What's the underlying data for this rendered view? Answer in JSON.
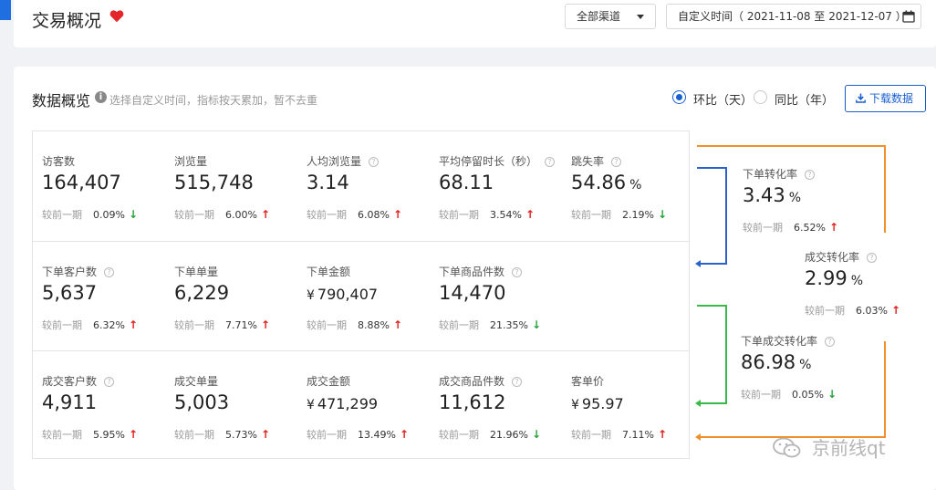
{
  "header": {
    "title": "交易概况",
    "channel": "全部渠道",
    "date_label": "自定义时间",
    "date_range": "（ 2021-11-08 至 2021-12-07 ）"
  },
  "overview": {
    "title": "数据概览",
    "hint": "选择自定义时间，指标按天累加，暂不去重",
    "ring_label": "环比（天）",
    "yoy_label": "同比（年）",
    "download_label": "下载数据"
  },
  "compare_label": "较前一期",
  "rows": [
    [
      {
        "label": "访客数",
        "help": false,
        "currency": "",
        "value": "164,407",
        "unit": "",
        "change": "0.09%",
        "dir": "down"
      },
      {
        "label": "浏览量",
        "help": false,
        "currency": "",
        "value": "515,748",
        "unit": "",
        "change": "6.00%",
        "dir": "up"
      },
      {
        "label": "人均浏览量",
        "help": true,
        "currency": "",
        "value": "3.14",
        "unit": "",
        "change": "6.08%",
        "dir": "up"
      },
      {
        "label": "平均停留时长（秒）",
        "help": true,
        "currency": "",
        "value": "68.11",
        "unit": "",
        "change": "3.54%",
        "dir": "up"
      },
      {
        "label": "跳失率",
        "help": true,
        "currency": "",
        "value": "54.86",
        "unit": "%",
        "change": "2.19%",
        "dir": "down"
      }
    ],
    [
      {
        "label": "下单客户数",
        "help": true,
        "currency": "",
        "value": "5,637",
        "unit": "",
        "change": "6.32%",
        "dir": "up"
      },
      {
        "label": "下单单量",
        "help": false,
        "currency": "",
        "value": "6,229",
        "unit": "",
        "change": "7.71%",
        "dir": "up"
      },
      {
        "label": "下单金额",
        "help": false,
        "currency": "¥",
        "value": "790,407",
        "unit": "",
        "change": "8.88%",
        "dir": "up"
      },
      {
        "label": "下单商品件数",
        "help": true,
        "currency": "",
        "value": "14,470",
        "unit": "",
        "change": "21.35%",
        "dir": "down"
      }
    ],
    [
      {
        "label": "成交客户数",
        "help": true,
        "currency": "",
        "value": "4,911",
        "unit": "",
        "change": "5.95%",
        "dir": "up"
      },
      {
        "label": "成交单量",
        "help": false,
        "currency": "",
        "value": "5,003",
        "unit": "",
        "change": "5.73%",
        "dir": "up"
      },
      {
        "label": "成交金额",
        "help": false,
        "currency": "¥",
        "value": "471,299",
        "unit": "",
        "change": "13.49%",
        "dir": "up"
      },
      {
        "label": "成交商品件数",
        "help": true,
        "currency": "",
        "value": "11,612",
        "unit": "",
        "change": "21.96%",
        "dir": "down"
      },
      {
        "label": "客单价",
        "help": false,
        "currency": "¥",
        "value": "95.97",
        "unit": "",
        "change": "7.11%",
        "dir": "up"
      }
    ]
  ],
  "conversions": [
    {
      "label": "下单转化率",
      "value": "3.43",
      "unit": "%",
      "change": "6.52%",
      "dir": "up"
    },
    {
      "label": "成交转化率",
      "value": "2.99",
      "unit": "%",
      "change": "6.03%",
      "dir": "up"
    },
    {
      "label": "下单成交转化率",
      "value": "86.98",
      "unit": "%",
      "change": "0.05%",
      "dir": "down"
    }
  ],
  "colors": {
    "accent": "#1a5fd0",
    "up": "#e0201b",
    "down": "#25a43a",
    "orange": "#f0902a",
    "blue": "#2a62c9",
    "green": "#3bb84a"
  },
  "watermark": "京前线qt"
}
